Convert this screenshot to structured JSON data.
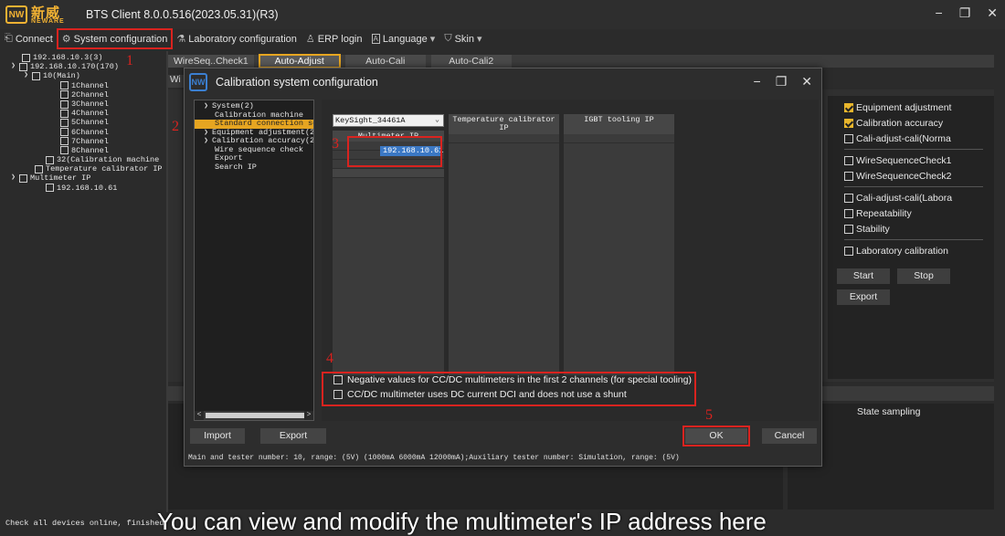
{
  "app": {
    "logo_cn": "新威",
    "logo_en": "NEWARE",
    "logo_mark": "NW",
    "title": "BTS Client 8.0.0.516(2023.05.31)(R3)"
  },
  "window_controls": {
    "minimize": "−",
    "restore": "❐",
    "close": "✕"
  },
  "menu": [
    {
      "label": "Connect",
      "icon": "connect-icon",
      "glyph": "⎗"
    },
    {
      "label": "System configuration",
      "icon": "gear-icon",
      "glyph": "⚙"
    },
    {
      "label": "Laboratory configuration",
      "icon": "flask-icon",
      "glyph": "⚗"
    },
    {
      "label": "ERP login",
      "icon": "user-icon",
      "glyph": "♙"
    },
    {
      "label": "Language",
      "icon": "language-icon",
      "glyph": "A"
    },
    {
      "label": "Skin",
      "icon": "shirt-icon",
      "glyph": "⛉"
    }
  ],
  "menu_dropdown_glyph": "▾",
  "step_numbers": [
    "1",
    "2",
    "3",
    "4",
    "5"
  ],
  "device_tree": [
    "192.168.10.3(3)",
    "192.168.10.170(170)",
    "10(Main)",
    "1Channel",
    "2Channel",
    "3Channel",
    "4Channel",
    "5Channel",
    "6Channel",
    "7Channel",
    "8Channel",
    "32(Calibration machine",
    "Temperature calibrator IP",
    "Multimeter IP",
    "192.168.10.61"
  ],
  "tabs": [
    "WireSeq..Check1",
    "Auto-Adjust",
    "Auto-Cali",
    "Auto-Cali2"
  ],
  "wi_label": "Wi",
  "right_panel": {
    "options": [
      {
        "label": "Equipment adjustment",
        "checked": true
      },
      {
        "label": "Calibration accuracy",
        "checked": true
      },
      {
        "label": "Cali-adjust-cali(Norma",
        "checked": false
      },
      {
        "label": "WireSequenceCheck1",
        "checked": false
      },
      {
        "label": "WireSequenceCheck2",
        "checked": false
      },
      {
        "label": "Cali-adjust-cali(Labora",
        "checked": false
      },
      {
        "label": "Repeatability",
        "checked": false
      },
      {
        "label": "Stability",
        "checked": false
      },
      {
        "label": "Laboratory calibration",
        "checked": false
      }
    ],
    "start": "Start",
    "stop": "Stop",
    "export": "Export",
    "state_sampling": "State sampling"
  },
  "dialog": {
    "icon_mark": "NW",
    "title": "Calibration system configuration",
    "tree": [
      "System(2)",
      "Calibration machine",
      "Standard connection se",
      "Equipment adjustment(2",
      "Calibration accuracy(2",
      "Wire sequence check",
      "Export",
      "Search IP"
    ],
    "scroll_left": "<",
    "scroll_right": ">",
    "multimeter_select": "KeySight_34461A",
    "columns": {
      "multimeter_ip_header": "Multimeter IP",
      "multimeter_ip_value": "192.168.10.61",
      "temp_calibrator_header": "Temperature calibrator IP",
      "igbt_header": "IGBT tooling IP"
    },
    "options": [
      "Negative values for CC/DC multimeters in the first 2 channels (for special tooling)",
      "CC/DC multimeter uses DC current DCI and does not use a shunt"
    ],
    "import": "Import",
    "export": "Export",
    "ok": "OK",
    "cancel": "Cancel",
    "status": "Main and tester number: 10, range: (5V) (1000mA 6000mA 12000mA);Auxiliary tester number: Simulation, range: (5V)"
  },
  "status_bar": "Check all devices online, finished",
  "caption": "You can view and modify the multimeter's IP address here"
}
